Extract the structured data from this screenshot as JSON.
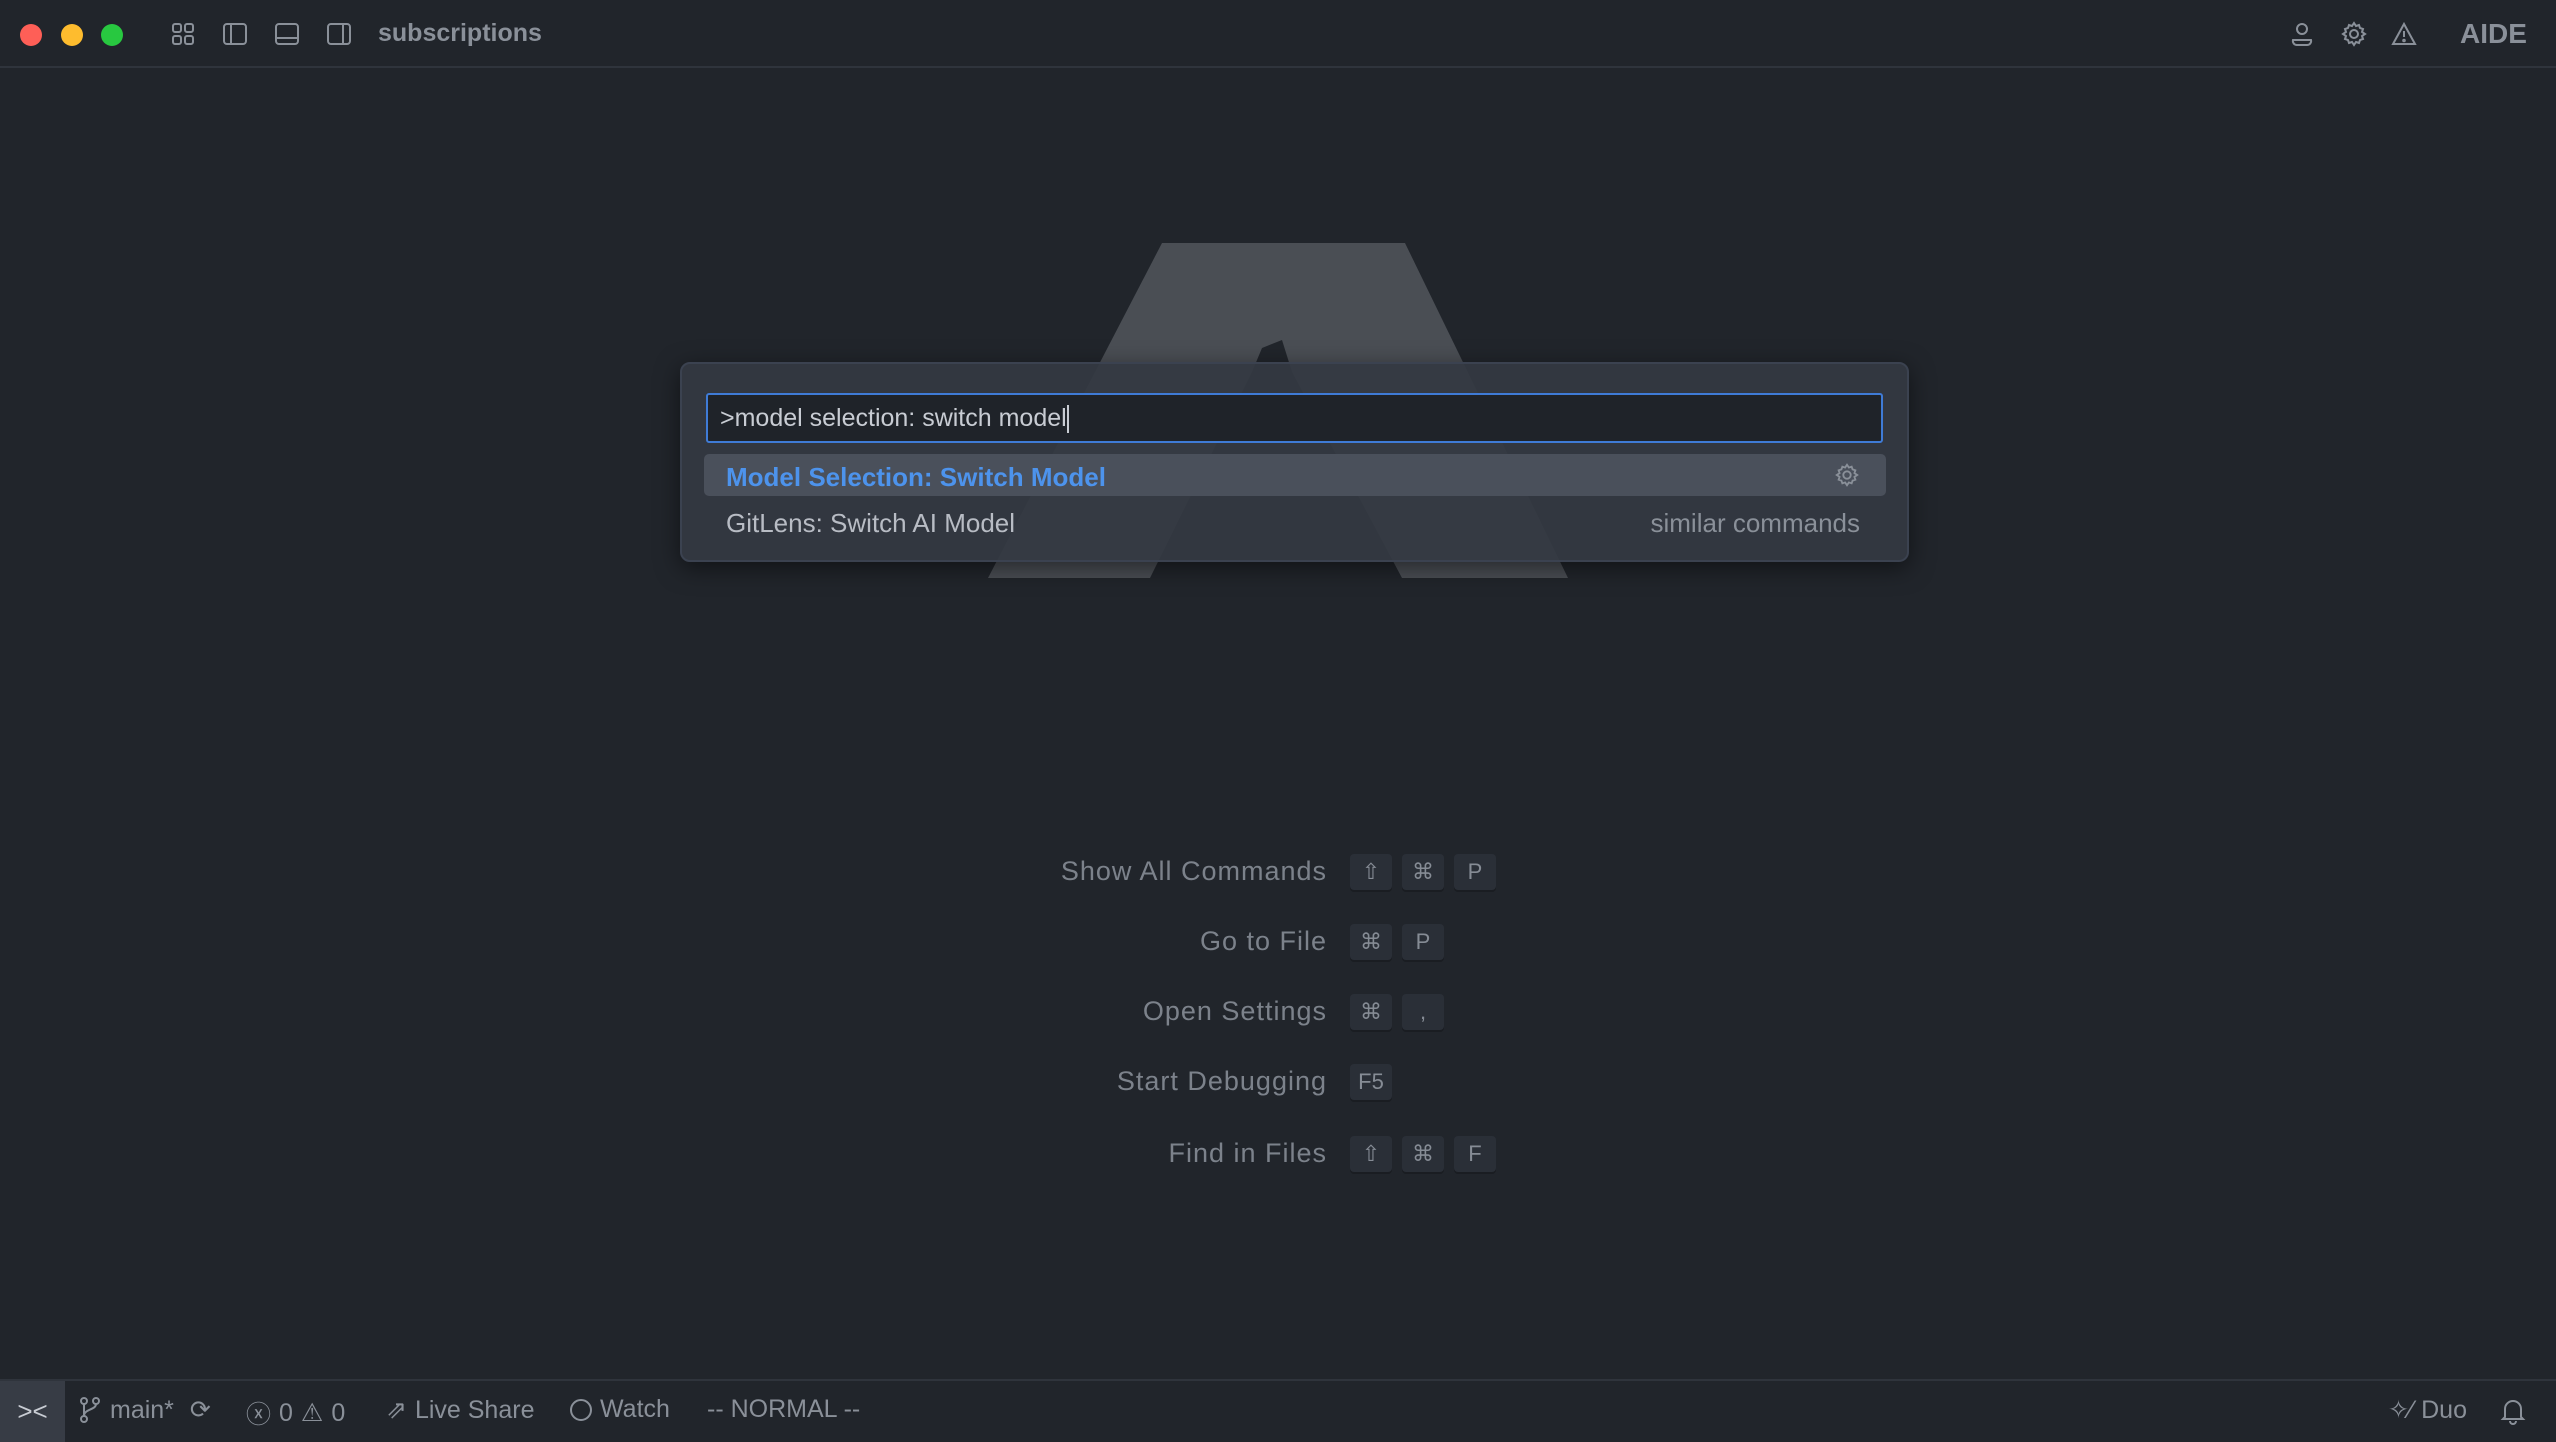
{
  "titlebar": {
    "title": "subscriptions",
    "brand": "AIDE",
    "traffic_lights": {
      "close": "#fe5f57",
      "minimize": "#febc2e",
      "maximize": "#28c840"
    }
  },
  "palette": {
    "input_value": ">model selection: switch model",
    "results": [
      {
        "label": "Model Selection: Switch Model",
        "selected": true,
        "icon": "gear-icon"
      },
      {
        "label": "GitLens: Switch AI Model",
        "hint": "similar commands"
      }
    ],
    "accent": "#4d93ec"
  },
  "shortcuts": [
    {
      "label": "Show All Commands",
      "keys": [
        "⇧",
        "⌘",
        "P"
      ]
    },
    {
      "label": "Go to File",
      "keys": [
        "⌘",
        "P"
      ]
    },
    {
      "label": "Open Settings",
      "keys": [
        "⌘",
        ","
      ]
    },
    {
      "label": "Start Debugging",
      "keys": [
        "F5"
      ]
    },
    {
      "label": "Find in Files",
      "keys": [
        "⇧",
        "⌘",
        "F"
      ]
    }
  ],
  "statusbar": {
    "remote": "><",
    "branch": "main*",
    "errors": "0",
    "warnings": "0",
    "live_share": "Live Share",
    "watch": "Watch",
    "mode": "-- NORMAL --",
    "duo": "Duo"
  }
}
